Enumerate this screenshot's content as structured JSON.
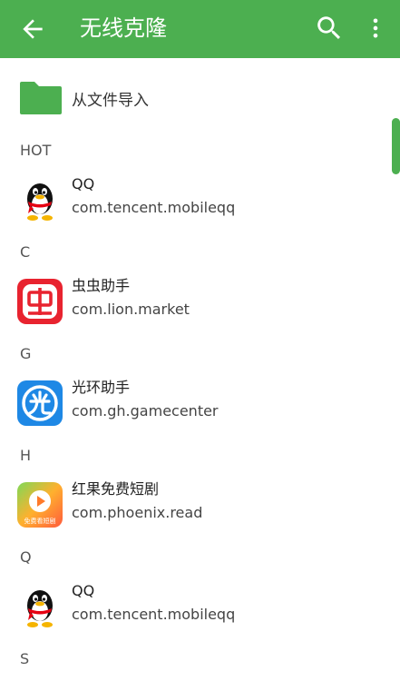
{
  "header": {
    "title": "无线克隆"
  },
  "import": {
    "label": "从文件导入"
  },
  "sections": [
    "HOT",
    "C",
    "G",
    "H",
    "Q",
    "S"
  ],
  "apps": [
    {
      "name": "QQ",
      "package": "com.tencent.mobileqq",
      "icon": "qq-penguin-icon"
    },
    {
      "name": "虫虫助手",
      "package": "com.lion.market",
      "icon": "chongchong-icon"
    },
    {
      "name": "光环助手",
      "package": "com.gh.gamecenter",
      "icon": "guanghuan-icon"
    },
    {
      "name": "红果免费短剧",
      "package": "com.phoenix.read",
      "icon": "hongguo-icon",
      "icon_caption": "免费看短剧"
    },
    {
      "name": "QQ",
      "package": "com.tencent.mobileqq",
      "icon": "qq-penguin-icon"
    }
  ],
  "colors": {
    "appbar": "#4caf50",
    "accent": "#4caf50"
  }
}
